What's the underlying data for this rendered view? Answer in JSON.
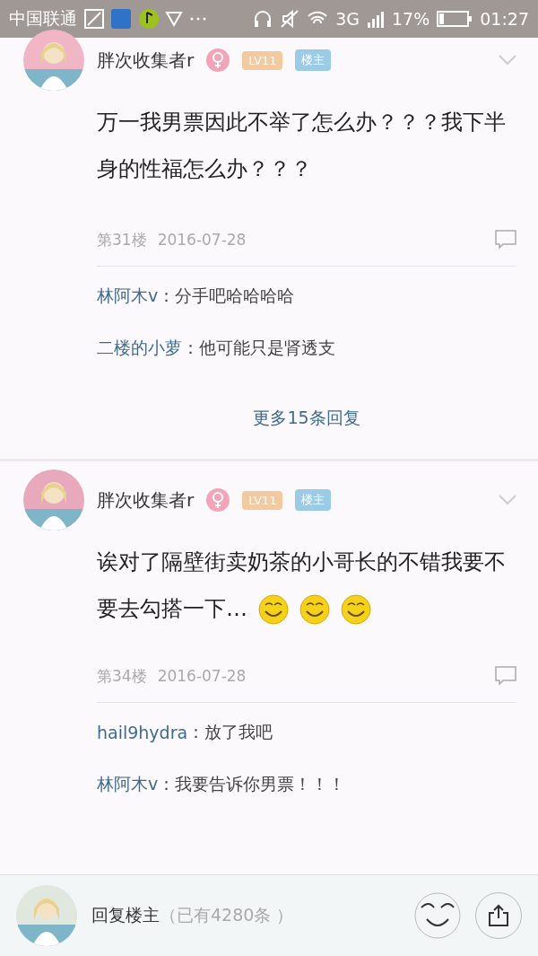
{
  "status_bar": {
    "carrier": "中国联通",
    "network": "3G",
    "battery": "17%",
    "time": "01:27"
  },
  "posts": [
    {
      "author": "胖次收集者r",
      "level": "LV11",
      "role": "楼主",
      "body": "万一我男票因此不举了怎么办？？？我下半身的性福怎么办？？？",
      "floor": "第31楼",
      "date": "2016-07-28",
      "replies": [
        {
          "name": "林阿木v",
          "text": "：分手吧哈哈哈哈"
        },
        {
          "name": "二楼的小萝",
          "text": "：他可能只是肾透支"
        }
      ],
      "more": "更多15条回复"
    },
    {
      "author": "胖次收集者r",
      "level": "LV11",
      "role": "楼主",
      "body": "诶对了隔壁街卖奶茶的小哥长的不错我要不要去勾搭一下…",
      "emojis": [
        {
          "kind": "grin"
        },
        {
          "kind": "grin"
        },
        {
          "kind": "grin"
        }
      ],
      "floor": "第34楼",
      "date": "2016-07-28",
      "replies": [
        {
          "name": "hail9hydra",
          "text": "：放了我吧"
        },
        {
          "name": "林阿木v",
          "text": "：我要告诉你男票！！！"
        }
      ]
    }
  ],
  "reply_bar": {
    "placeholder": "回复楼主",
    "count": "（已有4280条 ）"
  }
}
